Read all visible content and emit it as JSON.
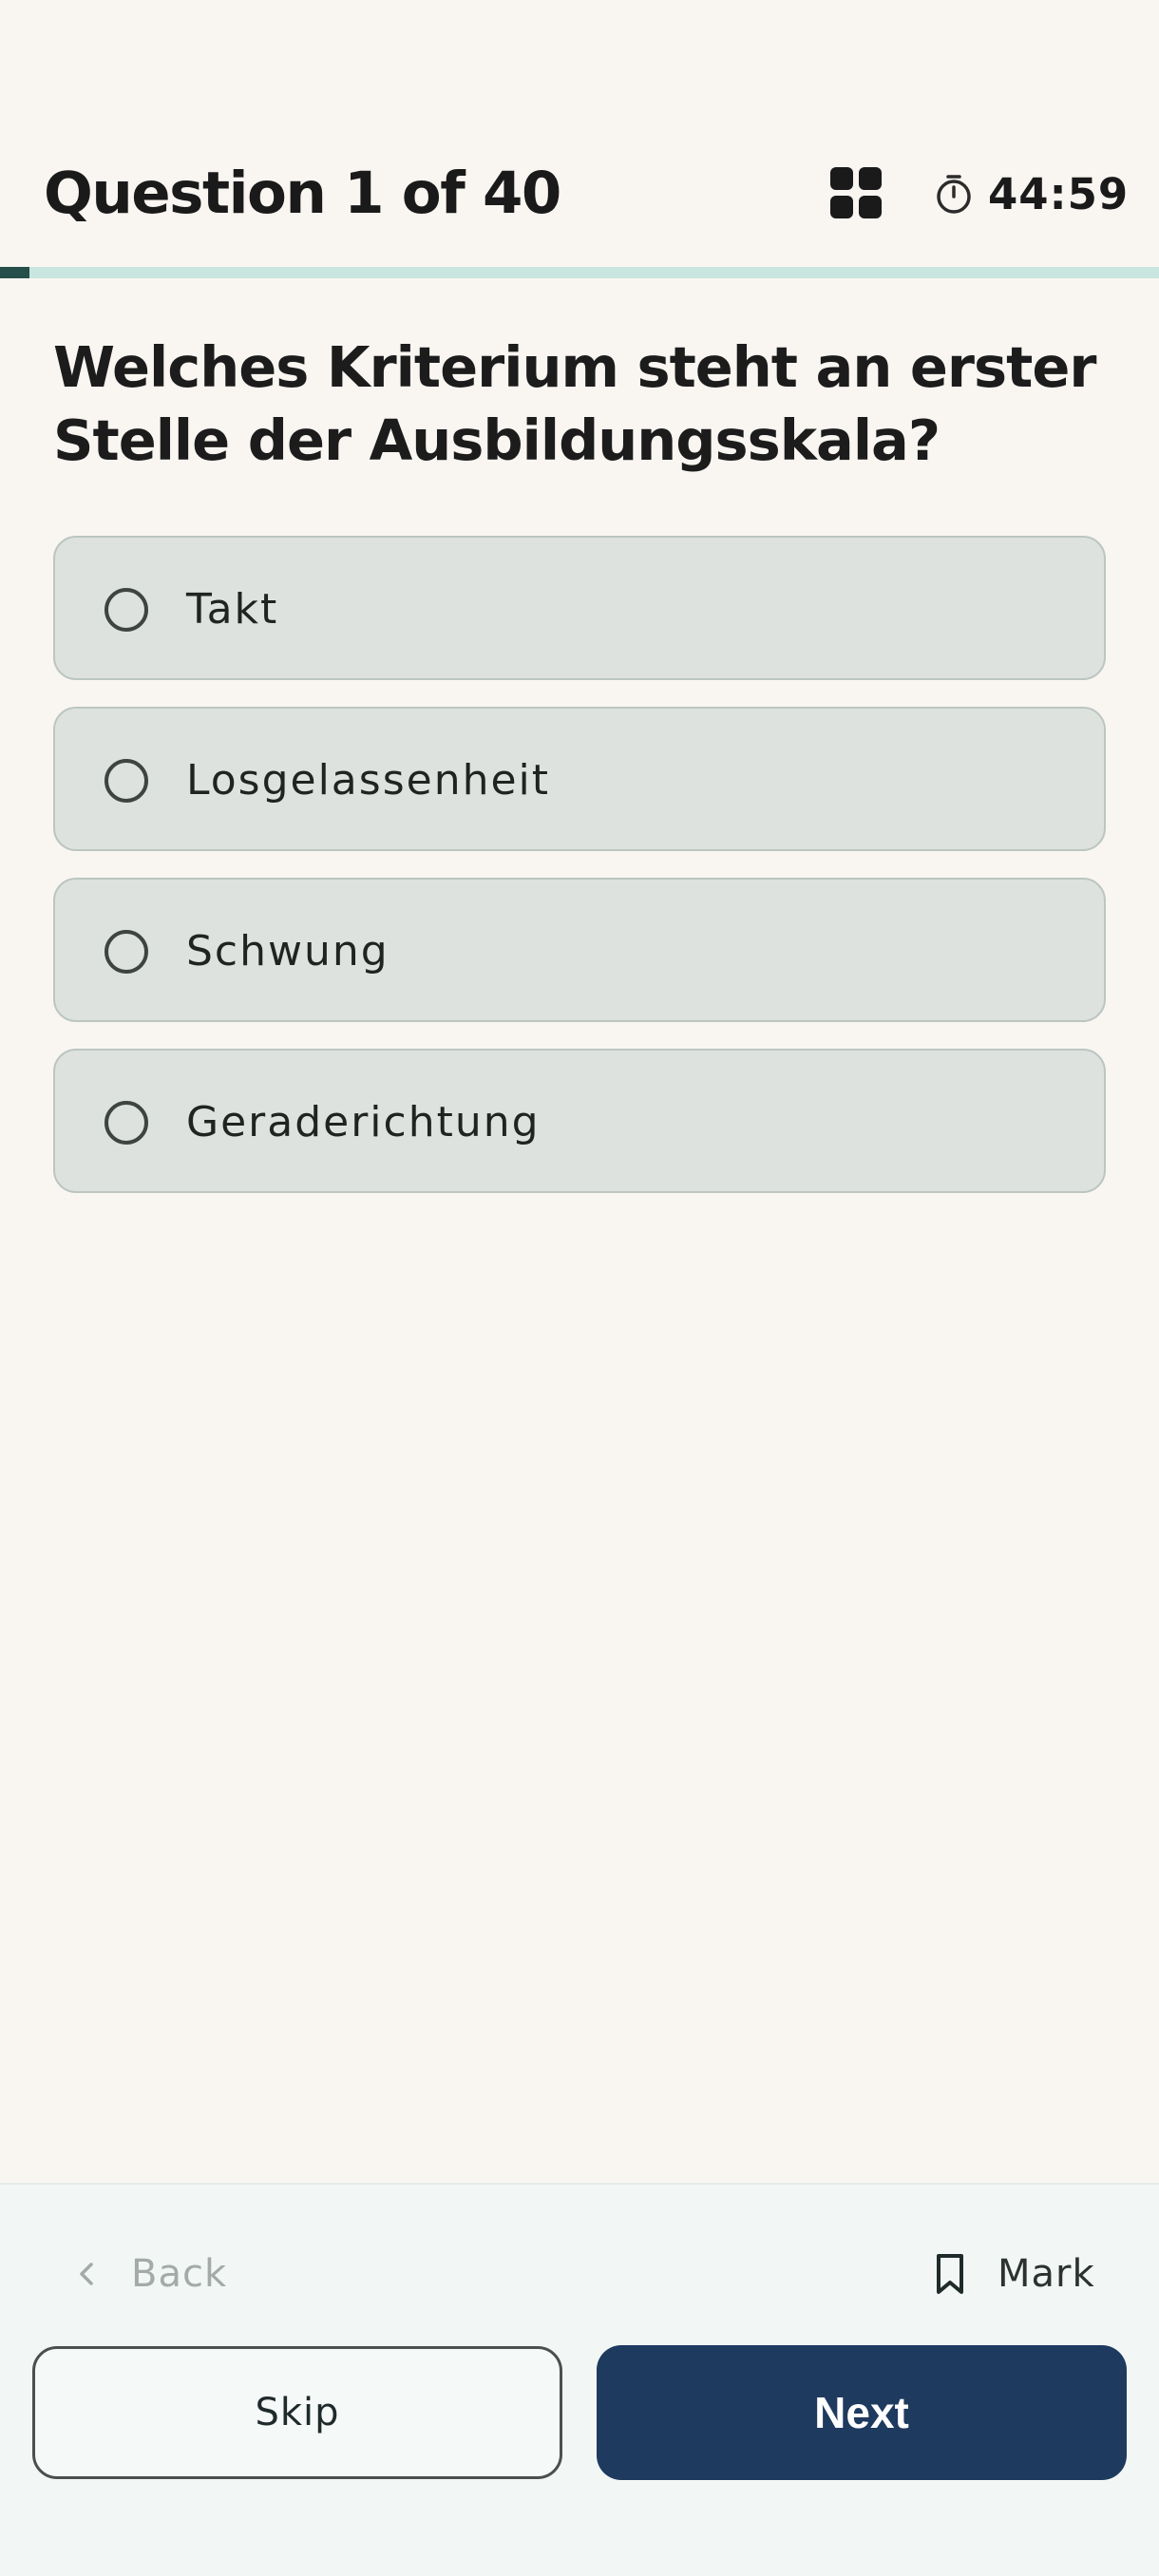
{
  "header": {
    "question_counter": "Question 1 of 40",
    "grid_icon": "question-grid-icon",
    "timer_icon": "stopwatch-icon",
    "timer_value": "44:59"
  },
  "progress": {
    "current": 1,
    "total": 40
  },
  "question": {
    "text": "Welches Kriterium steht an erster Stelle der Ausbildungsskala?"
  },
  "options": [
    {
      "label": "Takt",
      "selected": false
    },
    {
      "label": "Losgelassenheit",
      "selected": false
    },
    {
      "label": "Schwung",
      "selected": false
    },
    {
      "label": "Geraderichtung",
      "selected": false
    }
  ],
  "footer": {
    "back_label": "Back",
    "back_icon": "chevron-left-icon",
    "mark_label": "Mark",
    "mark_icon": "bookmark-icon",
    "skip_label": "Skip",
    "next_label": "Next"
  },
  "colors": {
    "background": "#f9f6f2",
    "accent": "#1f3a5f",
    "progress_fill": "#264e4a",
    "progress_track": "#c9e5df",
    "option_bg": "#dee2df"
  }
}
